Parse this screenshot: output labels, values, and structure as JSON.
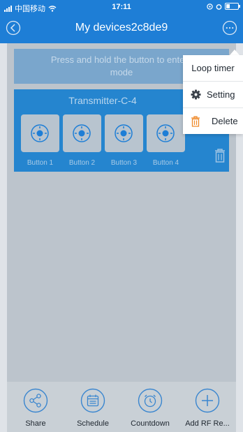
{
  "status_bar": {
    "carrier": "中国移动",
    "time": "17:11",
    "wifi_icon": "wifi-icon",
    "battery_level": 0.3
  },
  "nav": {
    "title": "My devices2c8de9",
    "back_icon": "back-circle-icon",
    "more_icon": "more-circle-icon"
  },
  "hint": {
    "line1": "Press and hold the button to enter i",
    "line2": "mode"
  },
  "device": {
    "name": "Transmitter-C-4",
    "buttons": [
      {
        "label": "Button 1",
        "icon": "target-icon"
      },
      {
        "label": "Button 2",
        "icon": "target-icon"
      },
      {
        "label": "Button 3",
        "icon": "target-icon"
      },
      {
        "label": "Button 4",
        "icon": "target-icon"
      }
    ],
    "delete_icon": "trash-icon"
  },
  "menu": {
    "items": [
      {
        "label": "Loop timer",
        "icon": ""
      },
      {
        "label": "Setting",
        "icon": "gear-icon"
      },
      {
        "label": "Delete",
        "icon": "trash-icon"
      }
    ]
  },
  "toolbar": {
    "items": [
      {
        "label": "Share",
        "icon": "share-icon"
      },
      {
        "label": "Schedule",
        "icon": "calendar-icon"
      },
      {
        "label": "Countdown",
        "icon": "alarm-clock-icon"
      },
      {
        "label": "Add RF Re...",
        "icon": "plus-icon"
      }
    ]
  },
  "colors": {
    "accent": "#1e7ed6",
    "delete_icon": "#ef8a2b",
    "overlay_background": "#bcc4cc"
  }
}
